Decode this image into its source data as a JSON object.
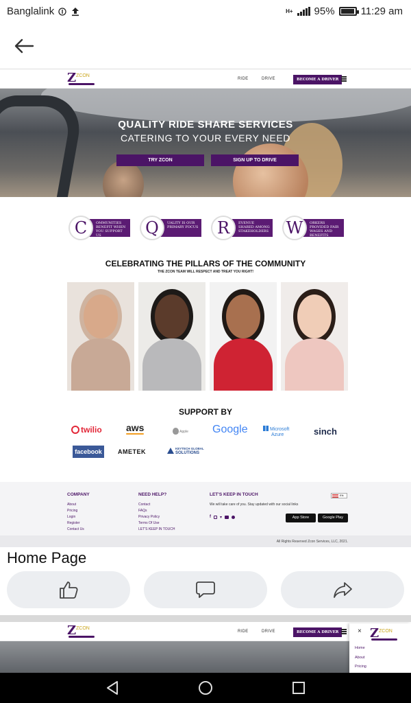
{
  "statusbar": {
    "carrier": "Banglalink",
    "network_type": "H+",
    "battery_percent": "95%",
    "battery_level": 0.95,
    "time": "11:29 am"
  },
  "caption": "Home Page",
  "site": {
    "logo_text": "ZCON",
    "nav": {
      "ride": "RIDE",
      "drive": "DRIVE",
      "become_driver": "BECOME A DRIVER"
    },
    "hero": {
      "title": "QUALITY RIDE SHARE SERVICES",
      "subtitle": "CATERING TO YOUR EVERY NEED",
      "try_button": "TRY ZCON",
      "signup_button": "SIGN UP TO DRIVE"
    },
    "pillars": [
      {
        "letter": "C",
        "text": "OMMUNITIES BENEFIT WHEN YOU SUPPORT US"
      },
      {
        "letter": "Q",
        "text": "UALITY IS OUR PRIMARY FOCUS"
      },
      {
        "letter": "R",
        "text": "EVENUE SHARED AMONG STAKEHOLDERS"
      },
      {
        "letter": "W",
        "text": "ORKERS PROVIDED FAIR WAGES AND BENEFITS"
      }
    ],
    "celebrate_title": "CELEBRATING THE PILLARS OF THE COMMUNITY",
    "celebrate_subtitle": "THE ZCON TEAM WILL RESPECT AND TREAT YOU RIGHT!",
    "support_title": "SUPPORT BY",
    "sponsors": {
      "twilio": "twilio",
      "aws": "aws",
      "apple": "Apple",
      "google": "Google",
      "azure_1": "Microsoft",
      "azure_2": "Azure",
      "sinch": "sinch",
      "facebook": "facebook",
      "ametek": "AMETEK",
      "keytech_1": "KEYTECH GLOBAL",
      "keytech_2": "SOLUTIONS"
    },
    "footer": {
      "company_heading": "COMPANY",
      "company_links": [
        "About",
        "Pricing",
        "Login",
        "Register",
        "Contact Us"
      ],
      "help_heading": "NEED HELP?",
      "help_links": [
        "Contact",
        "FAQs",
        "Privacy Policy",
        "Terms Of Use",
        "LET'S KEEP IN TOUCH"
      ],
      "touch_heading": "LET'S KEEP IN TOUCH",
      "touch_desc": "We will take care of you. Stay updated with our social links",
      "app_store": "App Store",
      "google_play": "Google Play",
      "language": "EN",
      "copyright": "All Rights Reserved Zcon Services, LLC, 2021."
    }
  },
  "second_shot": {
    "close": "×",
    "menu_items": [
      "Home",
      "About",
      "Pricing"
    ]
  },
  "colors": {
    "brand_purple": "#4b1466",
    "brand_gold": "#caa51a"
  }
}
